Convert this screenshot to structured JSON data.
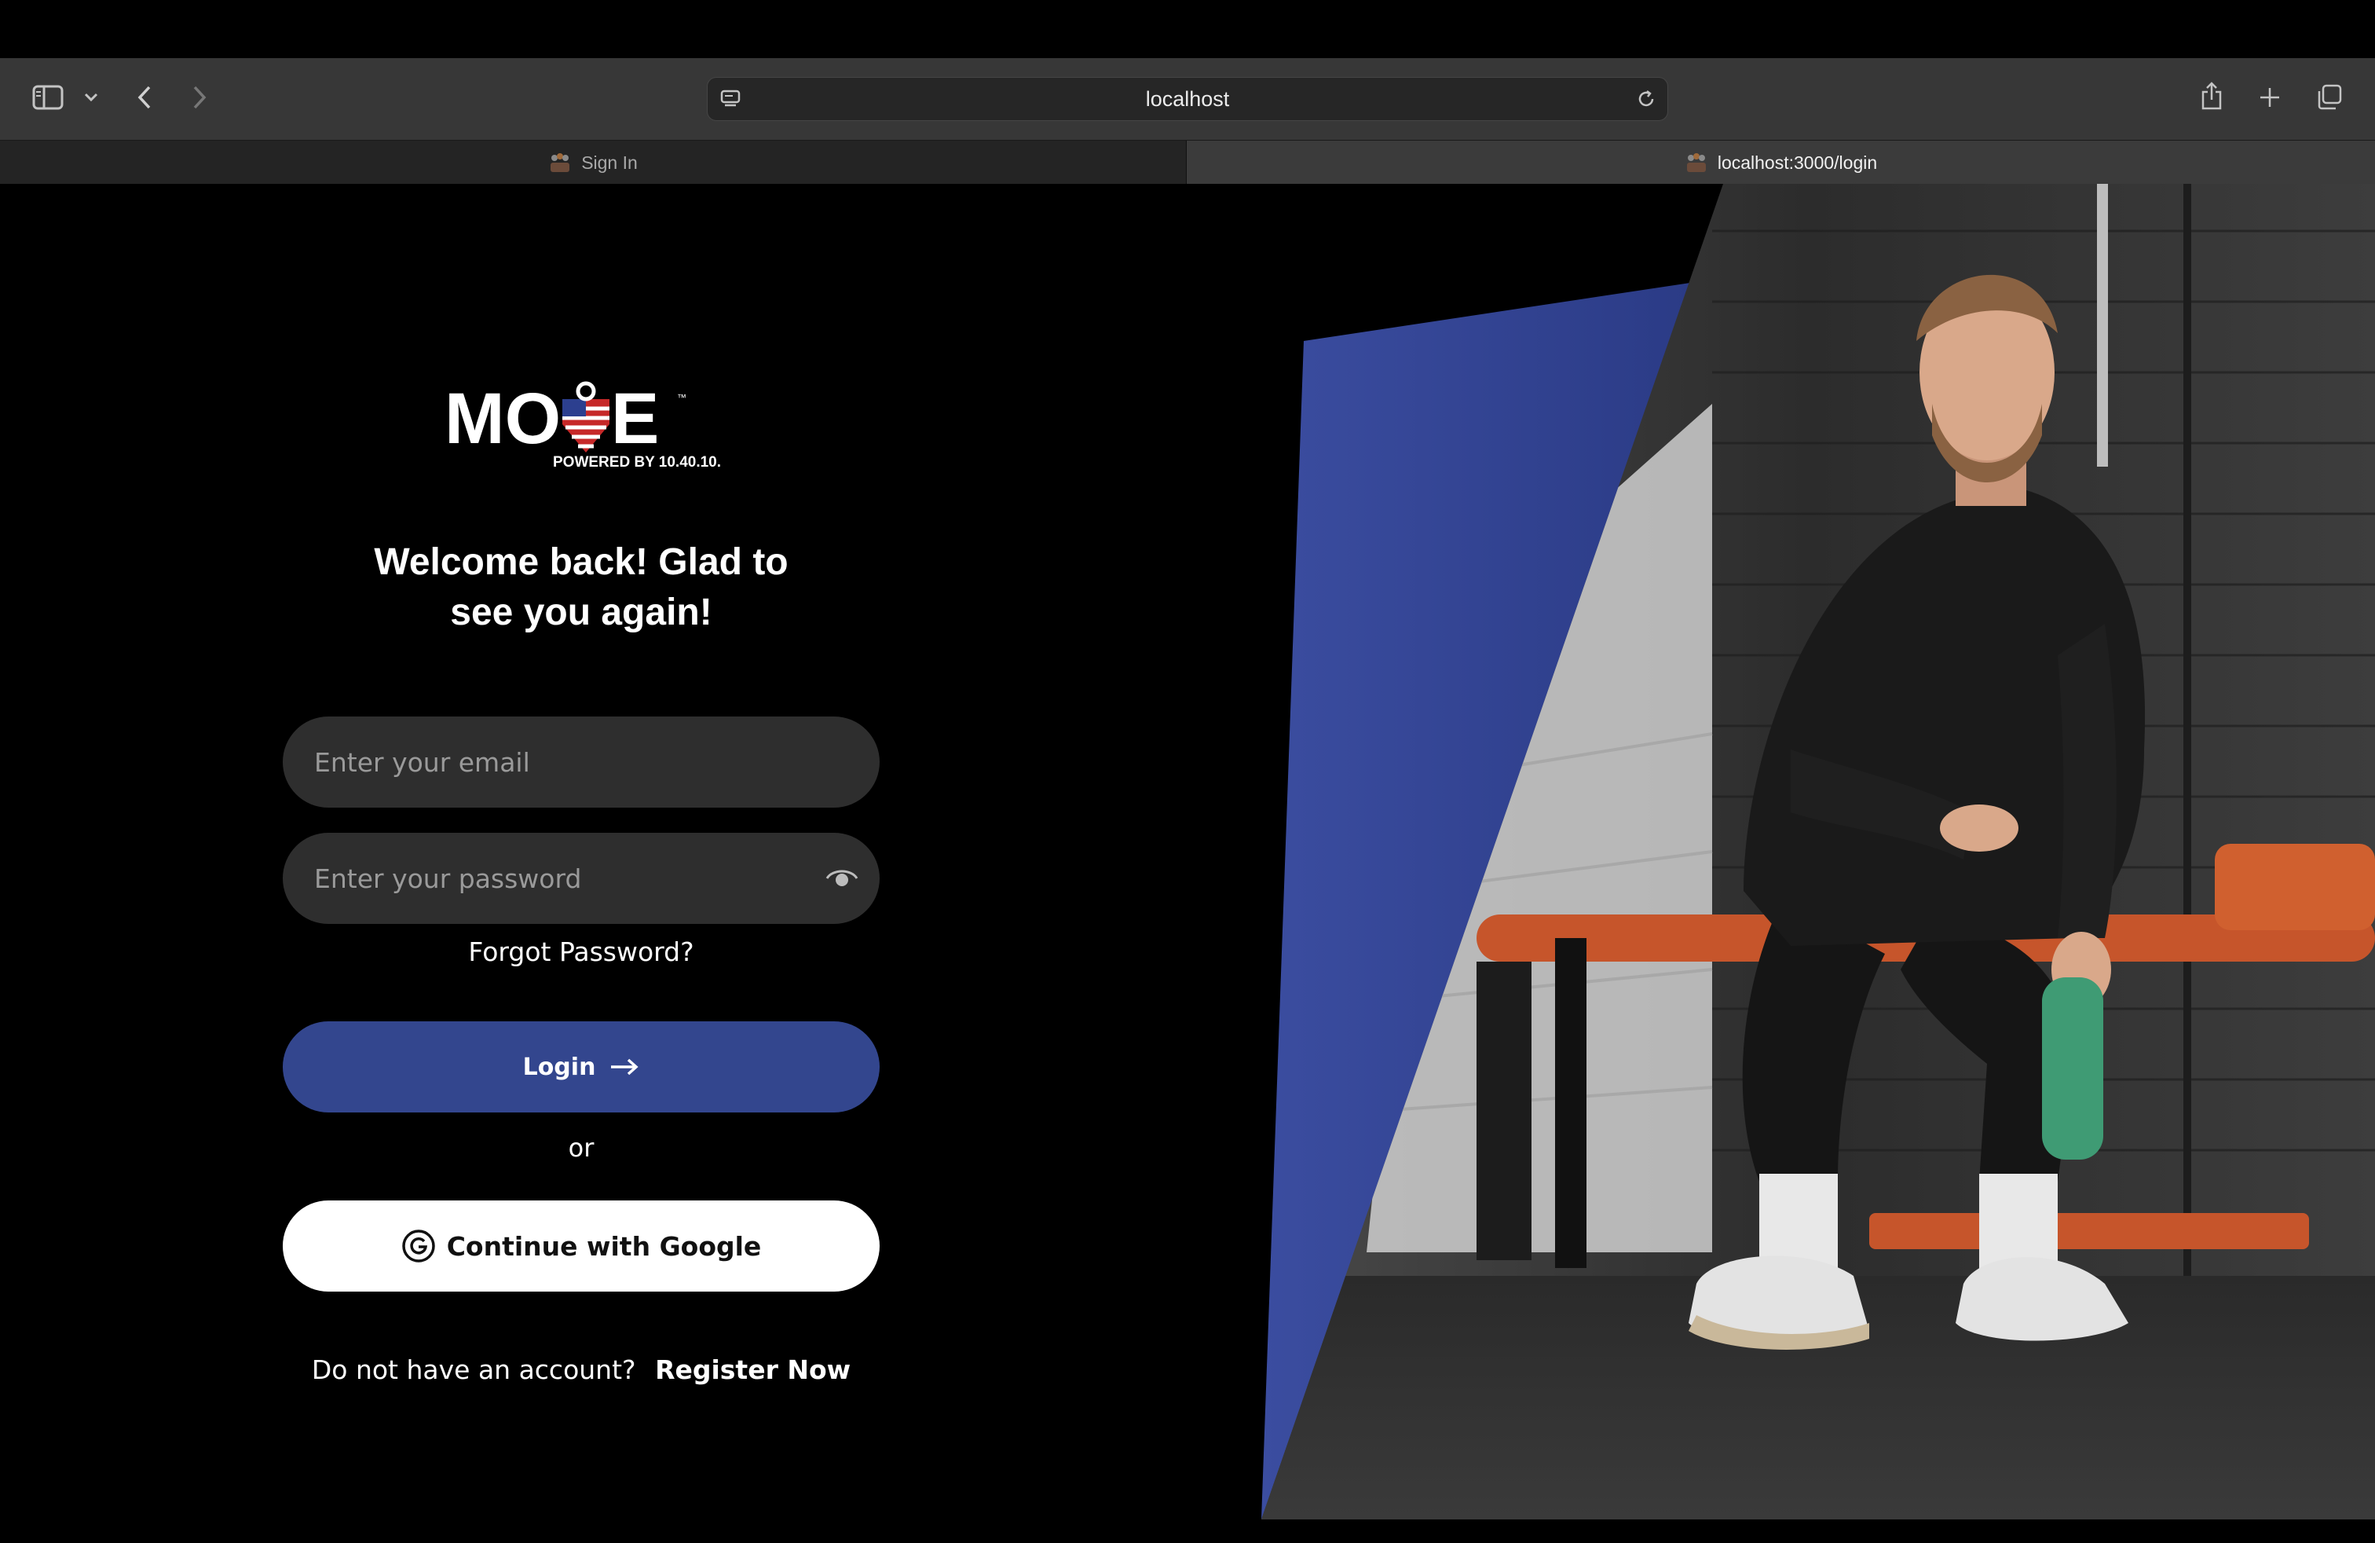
{
  "browser": {
    "address": "localhost",
    "tabs": [
      {
        "label": "Sign In",
        "active": false
      },
      {
        "label": "localhost:3000/login",
        "active": true
      }
    ]
  },
  "logo": {
    "wordmark": "MOVE",
    "tagline": "POWERED BY 10.40.10.",
    "trademark": "™"
  },
  "login_form": {
    "heading_line1": "Welcome back! Glad to",
    "heading_line2": "see you again!",
    "email_placeholder": "Enter your email",
    "password_placeholder": "Enter your password",
    "forgot_password": "Forgot Password?",
    "login_label": "Login",
    "or_label": "or",
    "google_label": "Continue with Google",
    "no_account_text": "Do not have an account?",
    "register_label": "Register Now"
  },
  "colors": {
    "primary": "#33468e",
    "field_bg": "#2e2e2e",
    "page_bg": "#000000",
    "accent_red": "#c62828"
  }
}
